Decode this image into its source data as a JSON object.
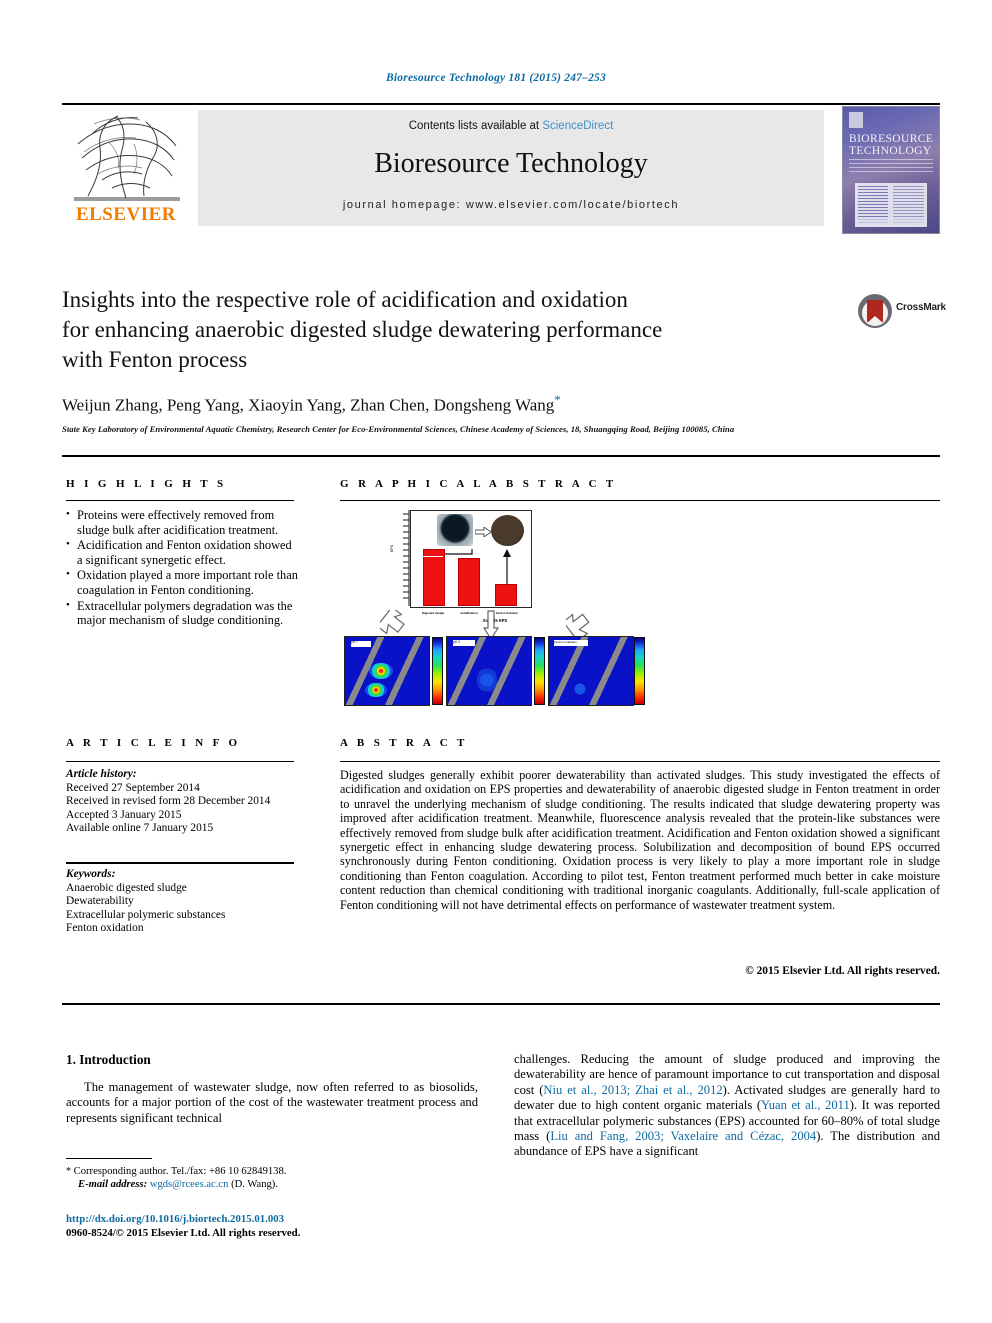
{
  "runninghead": "Bioresource Technology 181 (2015) 247–253",
  "masthead": {
    "publisher": "ELSEVIER",
    "contents_prefix": "Contents lists available at ",
    "contents_link": "ScienceDirect",
    "journal_title": "Bioresource Technology",
    "homepage": "journal homepage: www.elsevier.com/locate/biortech",
    "cover_line1": "BIORESOURCE",
    "cover_line2": "TECHNOLOGY"
  },
  "article": {
    "title_line1": "Insights into the respective role of acidification and oxidation",
    "title_line2": "for enhancing anaerobic digested sludge dewatering performance",
    "title_line3": "with Fenton process",
    "authors": "Weijun Zhang, Peng Yang, Xiaoyin Yang, Zhan Chen, Dongsheng Wang",
    "author_mark": "*",
    "affiliation": "State Key Laboratory of Environmental Aquatic Chemistry, Research Center for Eco-Environmental Sciences, Chinese Academy of Sciences, 18, Shuangqing Road, Beijing 100085, China",
    "crossmark_label": "CrossMark"
  },
  "highlights": {
    "heading": "H I G H L I G H T S",
    "items": [
      "Proteins were effectively removed from sludge bulk after acidification treatment.",
      "Acidification and Fenton oxidation showed a significant synergetic effect.",
      "Oxidation played a more important role than coagulation in Fenton conditioning.",
      "Extracellular polymers degradation was the major mechanism of sludge conditioning."
    ]
  },
  "graphical_abstract": {
    "heading": "G R A P H I C A L   A B S T R A C T",
    "middle_caption": "Soluble EPS",
    "panel_labels": [
      "pH 7",
      "pH 3",
      "Fenton oxidation"
    ],
    "chart_categories": [
      "Digested sludge",
      "Acidification",
      "Fenton Solution"
    ],
    "yaxis_label": "EPS"
  },
  "article_info": {
    "heading": "A R T I C L E   I N F O",
    "history_label": "Article history:",
    "history": [
      "Received 27 September 2014",
      "Received in revised form 28 December 2014",
      "Accepted 3 January 2015",
      "Available online 7 January 2015"
    ],
    "keywords_label": "Keywords:",
    "keywords": [
      "Anaerobic digested sludge",
      "Dewaterability",
      "Extracellular polymeric substances",
      "Fenton oxidation"
    ]
  },
  "abstract": {
    "heading": "A B S T R A C T",
    "text": "Digested sludges generally exhibit poorer dewaterability than activated sludges. This study investigated the effects of acidification and oxidation on EPS properties and dewaterability of anaerobic digested sludge in Fenton treatment in order to unravel the underlying mechanism of sludge conditioning. The results indicated that sludge dewatering property was improved after acidification treatment. Meanwhile, fluorescence analysis revealed that the protein-like substances were effectively removed from sludge bulk after acidification treatment. Acidification and Fenton oxidation showed a significant synergetic effect in enhancing sludge dewatering process. Solubilization and decomposition of bound EPS occurred synchronously during Fenton conditioning. Oxidation process is very likely to play a more important role in sludge conditioning than Fenton coagulation. According to pilot test, Fenton treatment performed much better in cake moisture content reduction than chemical conditioning with traditional inorganic coagulants. Additionally, full-scale application of Fenton conditioning will not have detrimental effects on performance of wastewater treatment system.",
    "copyright": "© 2015 Elsevier Ltd. All rights reserved."
  },
  "body": {
    "section_number_title": "1. Introduction",
    "left_paragraph": "The management of wastewater sludge, now often referred to as biosolids, accounts for a major portion of the cost of the wastewater treatment process and represents significant technical",
    "right_paragraph_1": "challenges. Reducing the amount of sludge produced and improving the dewaterability are hence of paramount importance to cut transportation and disposal cost (",
    "right_cite_1": "Niu et al., 2013; Zhai et al., 2012",
    "right_paragraph_2": "). Activated sludges are generally hard to dewater due to high content organic materials (",
    "right_cite_2": "Yuan et al., 2011",
    "right_paragraph_3": "). It was reported that extracellular polymeric substances (EPS) accounted for 60–80% of total sludge mass (",
    "right_cite_3": "Liu and Fang, 2003; Vaxelaire and Cézac, 2004",
    "right_paragraph_4": "). The distribution and abundance of EPS have a significant"
  },
  "footnote": {
    "marker": "*",
    "corresponding": "Corresponding author. Tel./fax: +86 10 62849138.",
    "email_label": "E-mail address:",
    "email": "wgds@rcees.ac.cn",
    "email_suffix": "(D. Wang)."
  },
  "footer": {
    "doi": "http://dx.doi.org/10.1016/j.biortech.2015.01.003",
    "issn": "0960-8524/© 2015 Elsevier Ltd. All rights reserved."
  },
  "colors": {
    "link": "#0b6aa2",
    "sciencedirect": "#3f8fc9",
    "elsevier_orange": "#f07c00",
    "masthead_bg": "#e8e8e8",
    "bar_red": "#ee1111",
    "eem_blue": "#0a12c8"
  },
  "chart_data": {
    "type": "bar",
    "title": "",
    "categories": [
      "Digested sludge",
      "Acidification",
      "Fenton Solution"
    ],
    "values": [
      62,
      52,
      22
    ],
    "ylabel": "EPS",
    "xlabel": "",
    "ylim": [
      0,
      80
    ],
    "grid": false,
    "legend": "none"
  }
}
